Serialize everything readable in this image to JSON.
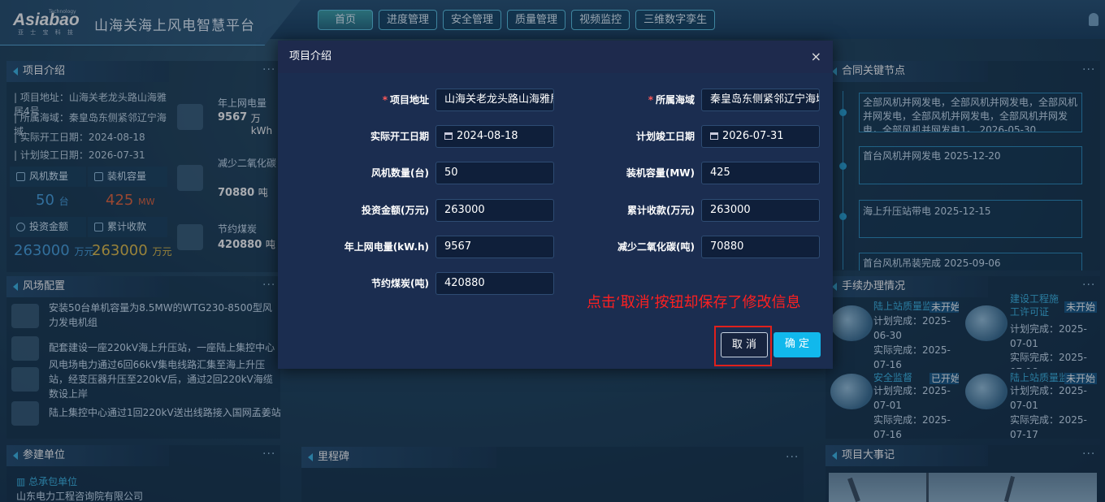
{
  "header": {
    "logo": "Asiabao",
    "logo_tech": "Technology",
    "logo_sub": "亚 士 宝 科 技",
    "title": "山海关海上风电智慧平台"
  },
  "nav": [
    "首页",
    "进度管理",
    "安全管理",
    "质量管理",
    "视频监控",
    "三维数字孪生"
  ],
  "project": {
    "panel_title": "项目介绍",
    "lines": [
      "| 项目地址：山海关老龙头路山海雅居4号",
      "| 所属海域：秦皇岛东侧紧邻辽宁海域",
      "| 实际开工日期：2024-08-18",
      "| 计划竣工日期：2026-07-31"
    ],
    "stats": [
      {
        "label": "风机数量",
        "value": "50",
        "unit": "台",
        "color": "#4aa3e0"
      },
      {
        "label": "装机容量",
        "value": "425",
        "unit": "MW",
        "color": "#e8663c"
      },
      {
        "label": "投资金额",
        "value": "263000",
        "unit": "万元",
        "color": "#4aa3e0"
      },
      {
        "label": "累计收款",
        "value": "263000",
        "unit": "万元",
        "color": "#e6c14a"
      }
    ],
    "side": [
      {
        "label": "年上网电量",
        "value": "9567",
        "unit": "万kWh"
      },
      {
        "label": "减少二氧化碳",
        "value": "70880",
        "unit": "吨"
      },
      {
        "label": "节约煤炭",
        "value": "420880",
        "unit": "吨"
      }
    ]
  },
  "farm": {
    "panel_title": "风场配置",
    "items": [
      "安装50台单机容量为8.5MW的WTG230-8500型风力发电机组",
      "配套建设一座220kV海上升压站，一座陆上集控中心",
      "风电场电力通过6回66kV集电线路汇集至海上升压站，经变压器升压至220kV后，通过2回220kV海缆数设上岸",
      "陆上集控中心通过1回220kV送出线路接入国网孟姜站"
    ]
  },
  "units": {
    "panel_title": "参建单位",
    "sub": "总承包单位",
    "company": "山东电力工程咨询院有限公司"
  },
  "milestone": {
    "panel_title": "里程碑"
  },
  "contract": {
    "panel_title": "合同关键节点",
    "nodes": [
      "全部风机并网发电，全部风机并网发电，全部风机并网发电，全部风机并网发电，全部风机并网发电，全部风机并网发电1。 2026-05-30",
      "首台风机并网发电 2025-12-20",
      "海上升压站带电 2025-12-15",
      "首台风机吊装完成 2025-09-06"
    ]
  },
  "procedures": {
    "panel_title": "手续办理情况",
    "cards": [
      {
        "name": "陆上站质量监",
        "status": "未开始",
        "plan": "计划完成：2025-06-30",
        "actual": "实际完成：2025-07-16"
      },
      {
        "name": "建设工程施工许可证",
        "status": "未开始",
        "plan": "计划完成：2025-07-01",
        "actual": "实际完成：2025-07-18"
      },
      {
        "name": "安全监督",
        "status": "已开始",
        "plan": "计划完成：2025-07-01",
        "actual": "实际完成：2025-07-16"
      },
      {
        "name": "陆上站质量监",
        "status": "未开始",
        "plan": "计划完成：2025-07-01",
        "actual": "实际完成：2025-07-17"
      }
    ]
  },
  "events": {
    "panel_title": "项目大事记"
  },
  "modal": {
    "title": "项目介绍",
    "close": "×",
    "fields": [
      {
        "label": "项目地址",
        "required": true,
        "value": "山海关老龙头路山海雅居4号"
      },
      {
        "label": "所属海域",
        "required": true,
        "value": "秦皇岛东侧紧邻辽宁海域"
      },
      {
        "label": "实际开工日期",
        "value": "2024-08-18",
        "date": true
      },
      {
        "label": "计划竣工日期",
        "value": "2026-07-31",
        "date": true
      },
      {
        "label": "风机数量(台)",
        "value": "50"
      },
      {
        "label": "装机容量(MW)",
        "value": "425"
      },
      {
        "label": "投资金额(万元)",
        "value": "263000"
      },
      {
        "label": "累计收款(万元)",
        "value": "263000"
      },
      {
        "label": "年上网电量(kW.h)",
        "value": "9567"
      },
      {
        "label": "减少二氧化碳(吨)",
        "value": "70880"
      },
      {
        "label": "节约煤炭(吨)",
        "value": "420880"
      }
    ],
    "cancel": "取 消",
    "ok": "确 定"
  },
  "annotation": "点击‘取消’按钮却保存了修改信息"
}
